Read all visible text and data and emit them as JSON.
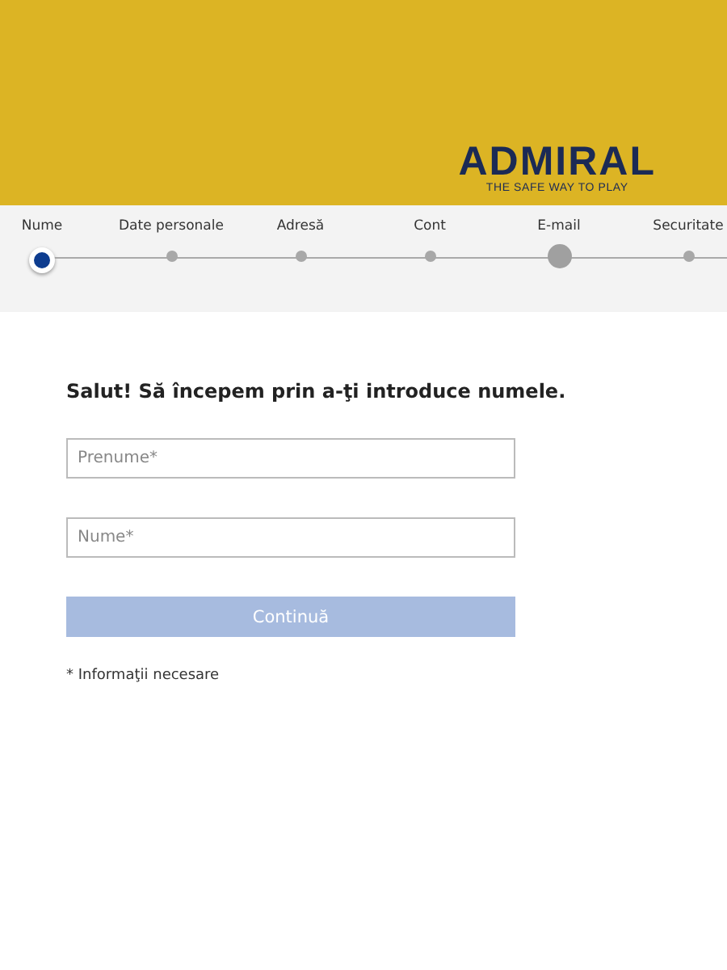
{
  "header": {
    "logo": "ADMIRAL",
    "tagline": "THE SAFE WAY TO PLAY"
  },
  "steps": [
    {
      "label": "Nume",
      "kind": "current"
    },
    {
      "label": "Date personale",
      "kind": "pending"
    },
    {
      "label": "Adresă",
      "kind": "pending"
    },
    {
      "label": "Cont",
      "kind": "pending"
    },
    {
      "label": "E-mail",
      "kind": "focused"
    },
    {
      "label": "Securitate",
      "kind": "pending"
    }
  ],
  "form": {
    "heading": "Salut! Să începem prin a-ţi introduce numele.",
    "fields": [
      {
        "placeholder": "Prenume*"
      },
      {
        "placeholder": "Nume*"
      }
    ],
    "button": {
      "label": "Continuă",
      "disabled": true
    },
    "note": "* Informaţii necesare"
  }
}
